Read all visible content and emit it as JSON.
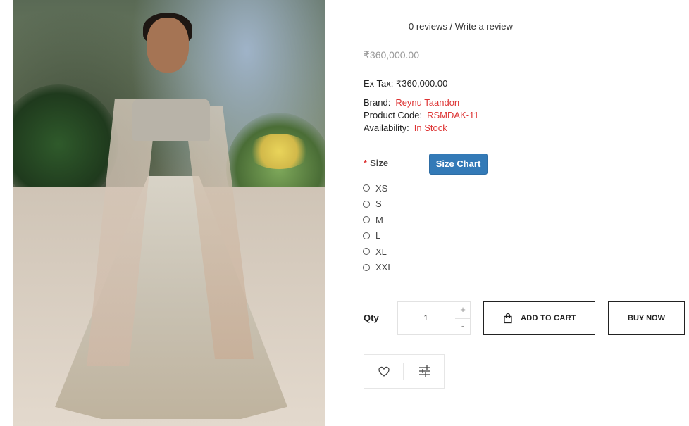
{
  "reviews": {
    "text": "0 reviews / Write a review"
  },
  "product": {
    "price": "₹360,000.00",
    "ex_tax": "Ex Tax: ₹360,000.00",
    "brand_label": "Brand:",
    "brand_value": "Reynu Taandon",
    "code_label": "Product Code:",
    "code_value": "RSMDAK-11",
    "availability_label": "Availability:",
    "availability_value": "In Stock"
  },
  "size": {
    "required_mark": "*",
    "label": "Size",
    "chart_button": "Size Chart",
    "options": [
      "XS",
      "S",
      "M",
      "L",
      "XL",
      "XXL"
    ]
  },
  "qty": {
    "label": "Qty",
    "value": "1",
    "plus": "+",
    "minus": "-"
  },
  "buttons": {
    "add_to_cart": "ADD TO CART",
    "buy_now": "BUY NOW"
  },
  "icons": {
    "cart": "shopping-bag-icon",
    "wishlist": "heart-icon",
    "compare": "sliders-icon"
  },
  "colors": {
    "accent_red": "#dd3333",
    "size_chart_blue": "#337ab7"
  }
}
